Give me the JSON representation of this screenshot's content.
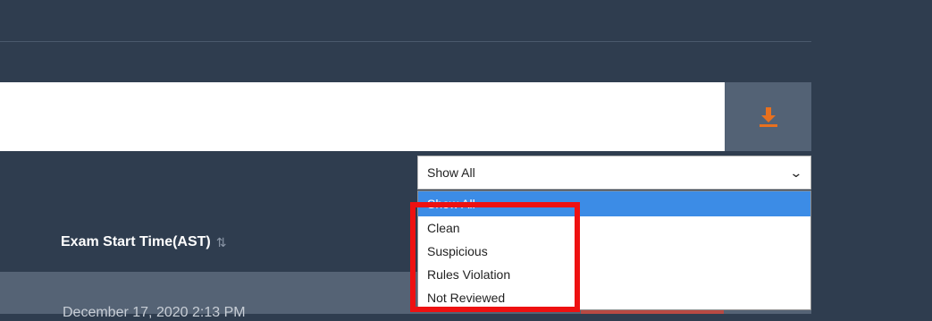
{
  "download": {
    "icon": "download-icon",
    "color": "#e8701e"
  },
  "table": {
    "header_exam_start": "Exam Start Time(AST)",
    "sort_glyph": "⇅",
    "row1_date": "December 17, 2020 2:13 PM"
  },
  "filter": {
    "selected": "Show All",
    "options": [
      "Show All",
      "Clean",
      "Suspicious",
      "Rules Violation",
      "Not Reviewed"
    ]
  },
  "colors": {
    "highlight": "#ee1111",
    "option_selected": "#3c8ce6"
  }
}
